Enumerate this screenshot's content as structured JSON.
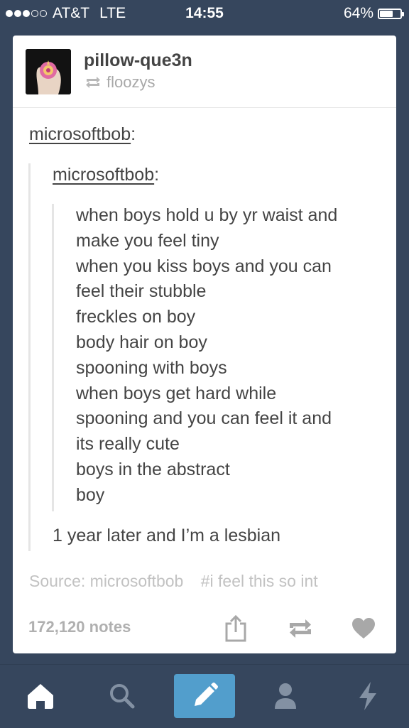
{
  "status_bar": {
    "signal": {
      "filled_dots": 3,
      "empty_dots": 2
    },
    "carrier": "AT&T",
    "network": "LTE",
    "time": "14:55",
    "battery_label": "64%",
    "battery_level": 0.64
  },
  "post": {
    "blog_name": "pillow-que3n",
    "reblogged_from": "floozys",
    "trail": [
      {
        "user": "microsoftbob",
        "colon": ":"
      },
      {
        "user": "microsoftbob",
        "colon": ":"
      }
    ],
    "lines": [
      "when boys hold u by yr waist and",
      "make you feel tiny",
      "when you kiss boys and you can",
      "feel their stubble",
      "freckles on boy",
      "body hair on boy",
      "spooning with boys",
      "when boys get hard while",
      "spooning and you can feel it and",
      "its really cute",
      "boys in the abstract",
      "boy"
    ],
    "reply": "1 year later and I’m a lesbian",
    "source_label": "Source:",
    "source_user": "microsoftbob",
    "tag": "#i feel this so int",
    "notes": "172,120 notes"
  },
  "icons": {
    "share": "share-icon",
    "reblog": "reblog-icon",
    "like": "heart-icon"
  },
  "tabbar": {
    "items": [
      "home-icon",
      "search-icon",
      "compose-icon",
      "account-icon",
      "activity-icon"
    ],
    "accent": "#529ecc",
    "background": "#36465d"
  }
}
